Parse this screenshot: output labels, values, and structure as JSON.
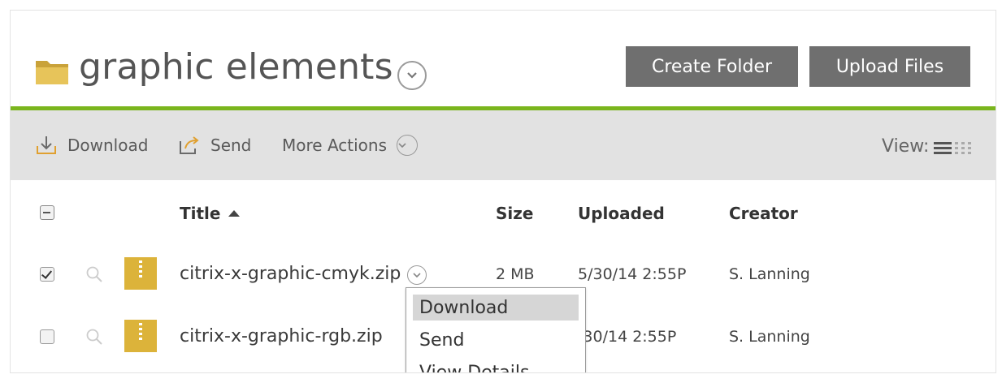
{
  "folder": {
    "title": "graphic elements",
    "icon": "folder-icon"
  },
  "header": {
    "create_folder_label": "Create Folder",
    "upload_files_label": "Upload Files"
  },
  "toolbar": {
    "download_label": "Download",
    "send_label": "Send",
    "more_actions_label": "More Actions",
    "view_label": "View:"
  },
  "table": {
    "columns": {
      "title": "Title",
      "size": "Size",
      "uploaded": "Uploaded",
      "creator": "Creator"
    },
    "rows": [
      {
        "name": "citrix-x-graphic-cmyk.zip",
        "size": "2 MB",
        "uploaded": "5/30/14 2:55P",
        "creator": "S. Lanning",
        "checked": true
      },
      {
        "name": "citrix-x-graphic-rgb.zip",
        "size": "",
        "uploaded": "/30/14 2:55P",
        "creator": "S. Lanning",
        "checked": false
      }
    ]
  },
  "context_menu": {
    "items": [
      "Download",
      "Send",
      "View Details"
    ],
    "highlighted": "Download"
  },
  "colors": {
    "accent_green": "#7ab51d",
    "button_gray": "#6f6f6f",
    "toolbar_gray": "#e2e2e2",
    "zip_gold": "#dcb33a"
  }
}
